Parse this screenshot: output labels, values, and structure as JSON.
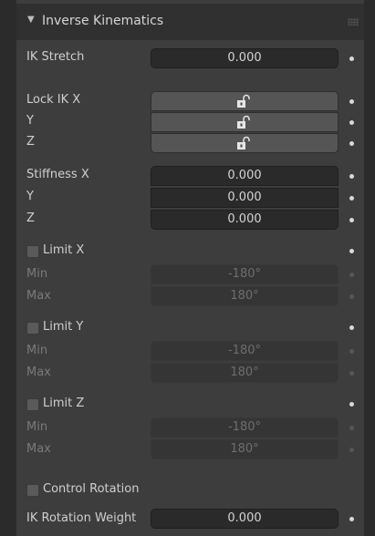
{
  "panel": {
    "title": "Inverse Kinematics",
    "expand_icon": "triangle-down-icon",
    "drag_icon": "grip-dots-icon"
  },
  "ik_stretch": {
    "label": "IK Stretch",
    "value": "0.000"
  },
  "lock": {
    "label_x": "Lock IK X",
    "label_y": "Y",
    "label_z": "Z",
    "icon": "unlocked-padlock-icon"
  },
  "stiffness": {
    "label_x": "Stiffness X",
    "label_y": "Y",
    "label_z": "Z",
    "x": "0.000",
    "y": "0.000",
    "z": "0.000"
  },
  "limit_x": {
    "label": "Limit X",
    "min_label": "Min",
    "max_label": "Max",
    "min": "-180°",
    "max": "180°"
  },
  "limit_y": {
    "label": "Limit Y",
    "min_label": "Min",
    "max_label": "Max",
    "min": "-180°",
    "max": "180°"
  },
  "limit_z": {
    "label": "Limit Z",
    "min_label": "Min",
    "max_label": "Max",
    "min": "-180°",
    "max": "180°"
  },
  "control_rotation": {
    "label": "Control Rotation"
  },
  "ik_rotation_weight": {
    "label": "IK Rotation Weight",
    "value": "0.000"
  },
  "colors": {
    "panel_bg": "#3d3d3d",
    "field_bg": "#2a2a2a",
    "lock_field_bg": "#555555",
    "lock_icon": "#e0e0e0"
  }
}
